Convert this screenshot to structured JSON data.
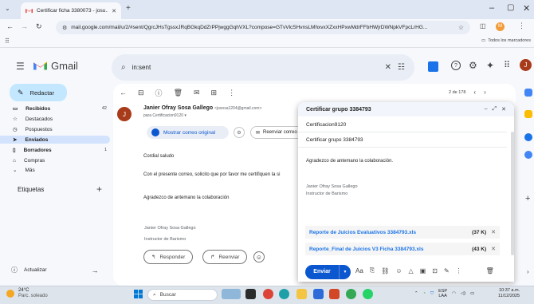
{
  "browser": {
    "tab_title": "Certificar ficha 3380073 - josu...",
    "url": "mail.google.com/mail/u/2/#sent/QgrcJHsTgssxJRqBGkqDdZrPPjwggGqhVXL?compose=GTvVlcSHvnsLMhxvxXZxxHPxwMdrFFbHWjrDWNpkVFpcLrHG...",
    "bookmarks_label": "Todos los marcadores"
  },
  "gmail": {
    "logo_text": "Gmail",
    "search_value": "in:sent",
    "compose_label": "Redactar",
    "nav": [
      {
        "label": "Recibidos",
        "count": "42",
        "bold": true
      },
      {
        "label": "Destacados",
        "count": ""
      },
      {
        "label": "Pospuestos",
        "count": ""
      },
      {
        "label": "Enviados",
        "count": "",
        "active": true
      },
      {
        "label": "Borradores",
        "count": "1",
        "bold": true
      },
      {
        "label": "Compras",
        "count": ""
      },
      {
        "label": "Más",
        "count": ""
      }
    ],
    "labels_title": "Etiquetas",
    "status_label": "Actualizar",
    "user_initial": "J"
  },
  "message": {
    "pager": "2 de 178",
    "avatar_initial": "J",
    "sender_name": "Janier Ofray Sosa Gallego",
    "sender_email": "<jososa1204@gmail.com>",
    "recipient": "para Certificacion9120",
    "show_original": "Mostrar correo original",
    "resend": "Reenviar correo",
    "greeting": "Cordial saludo",
    "body_line": "Con el presente correo, solicito que por favor me certifiquen la si",
    "thanks": "Agradezco de antemano la colaboración",
    "signature_name": "Janier Ofray Sosa Gallego",
    "signature_role": "Instructor de Barismo",
    "reply_label": "Responder",
    "forward_label": "Reenviar"
  },
  "compose": {
    "title": "Certificar grupo 3384793",
    "to": "Certificacion9120",
    "subject": "Certificar grupo 3384793",
    "thanks": "Agradezco de antemano la colaboración.",
    "signature_name": "Janier Ofray Sosa Gallego",
    "signature_role": "Instructor de Barismo",
    "attachments": [
      {
        "name": "Reporte de Juicios Evaluativos 3384793.xls",
        "size": "(37 K)"
      },
      {
        "name": "Reporte_Final de Juicios V3 Ficha 3384793.xls",
        "size": "(43 K)"
      }
    ],
    "send_label": "Enviar"
  },
  "taskbar": {
    "temp": "24°C",
    "weather": "Parc. soleado",
    "search": "Buscar",
    "lang1": "ESP",
    "lang2": "LAA",
    "time": "10:37 a.m.",
    "date": "11/12/2025"
  },
  "colors": {
    "accent": "#0b57d0",
    "compose_bg": "#c2e7ff",
    "active_nav": "#d3e3fd"
  }
}
